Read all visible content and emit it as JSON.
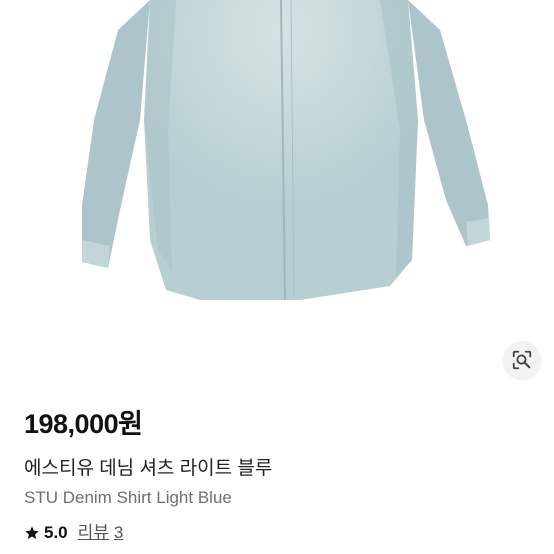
{
  "product": {
    "price": "198,000원",
    "title_ko": "에스티유 데님 셔츠 라이트 블루",
    "title_en": "STU Denim Shirt Light Blue",
    "rating": "5.0",
    "reviews_label": "리뷰",
    "reviews_count": "3"
  },
  "icons": {
    "image_search": "lens-search-icon",
    "star": "star-icon"
  },
  "colors": {
    "shirt": "#b8cfd3",
    "shirt_shadow": "#9fb8bd",
    "background": "#ffffff"
  }
}
